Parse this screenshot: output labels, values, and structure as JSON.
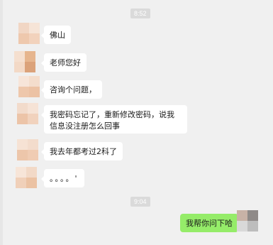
{
  "timestamps": [
    "8:52",
    "9:04"
  ],
  "messages": [
    {
      "text": "佛山"
    },
    {
      "text": "老师您好"
    },
    {
      "text": "咨询个问题，"
    },
    {
      "text": "我密码忘记了，重新修改密码，说我信息没注册怎么回事"
    },
    {
      "text": "我去年都考过2科了"
    },
    {
      "text": "。。。。'"
    },
    {
      "text": "我帮你问下哈"
    }
  ],
  "colors": {
    "background": "#f0f0f0",
    "incoming_bubble": "#ffffff",
    "outgoing_bubble": "#95ec69",
    "timestamp_bg": "#dadada"
  },
  "icons": {
    "avatar": "blurred-avatar-icon"
  }
}
